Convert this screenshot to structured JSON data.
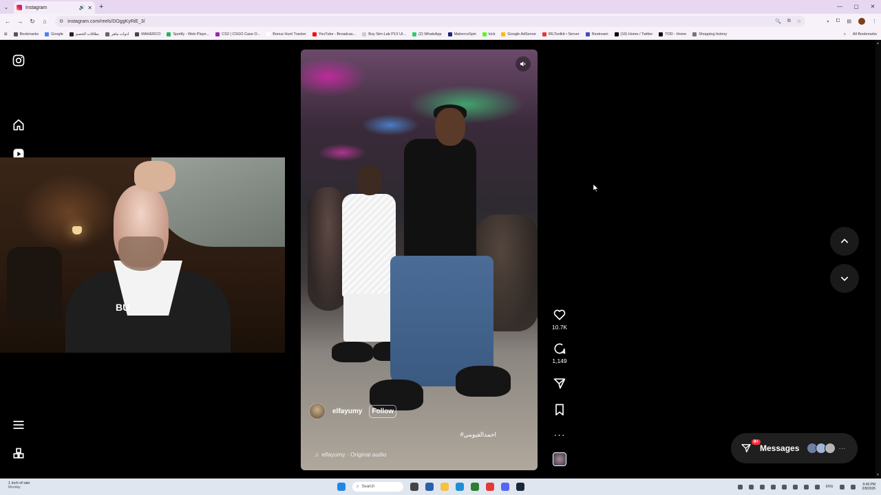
{
  "browser": {
    "tab_title": "Instagram",
    "url": "instagram.com/reels/DOggKyRiE_3/",
    "bookmarks": [
      {
        "label": "Bookmarks",
        "color": "#555555"
      },
      {
        "label": "Google",
        "color": "#4285f4"
      },
      {
        "label": "بطاقات الخصم",
        "color": "#222222"
      },
      {
        "label": "ادوات ماهر",
        "color": "#666666"
      },
      {
        "label": "MAHERCO",
        "color": "#444444"
      },
      {
        "label": "Spotify - Web Playe...",
        "color": "#1db954"
      },
      {
        "label": "CS2 | CSGO Case O...",
        "color": "#9c27b0"
      },
      {
        "label": "Bonus Hunt Tracker",
        "color": "#ffffff"
      },
      {
        "label": "YouTube - Broadcas...",
        "color": "#ff0000"
      },
      {
        "label": "Buy Sim-Lab P1X Ul...",
        "color": "#cccccc"
      },
      {
        "label": "(2) WhatsApp",
        "color": "#25d366"
      },
      {
        "label": "MahercoSpin",
        "color": "#1a237e"
      },
      {
        "label": "kick",
        "color": "#53fc18"
      },
      {
        "label": "Google AdSense",
        "color": "#fbbc04"
      },
      {
        "label": "IRLToolkit • Server",
        "color": "#e53935"
      },
      {
        "label": "Restream",
        "color": "#3f51b5"
      },
      {
        "label": "(16) Home / Twitter",
        "color": "#000000"
      },
      {
        "label": "TOD - Home",
        "color": "#111111"
      },
      {
        "label": "Shopping history",
        "color": "#777777"
      }
    ],
    "all_bookmarks": "All Bookmarks"
  },
  "webcam": {
    "shirt_text": "BU"
  },
  "reel": {
    "author": "elfayumy",
    "follow_label": "Follow",
    "caption": "#احمدالفيومي",
    "audio": "elfayumy · Original audio",
    "likes": "10.7K",
    "comments": "1,149"
  },
  "messages": {
    "label": "Messages",
    "badge": "9+"
  },
  "taskbar": {
    "weather_temp": "1 inch of rain",
    "weather_day": "Monday",
    "search_placeholder": "Search",
    "lang": "ENG",
    "time": "9:49 PM",
    "date": "2/8/2026"
  }
}
